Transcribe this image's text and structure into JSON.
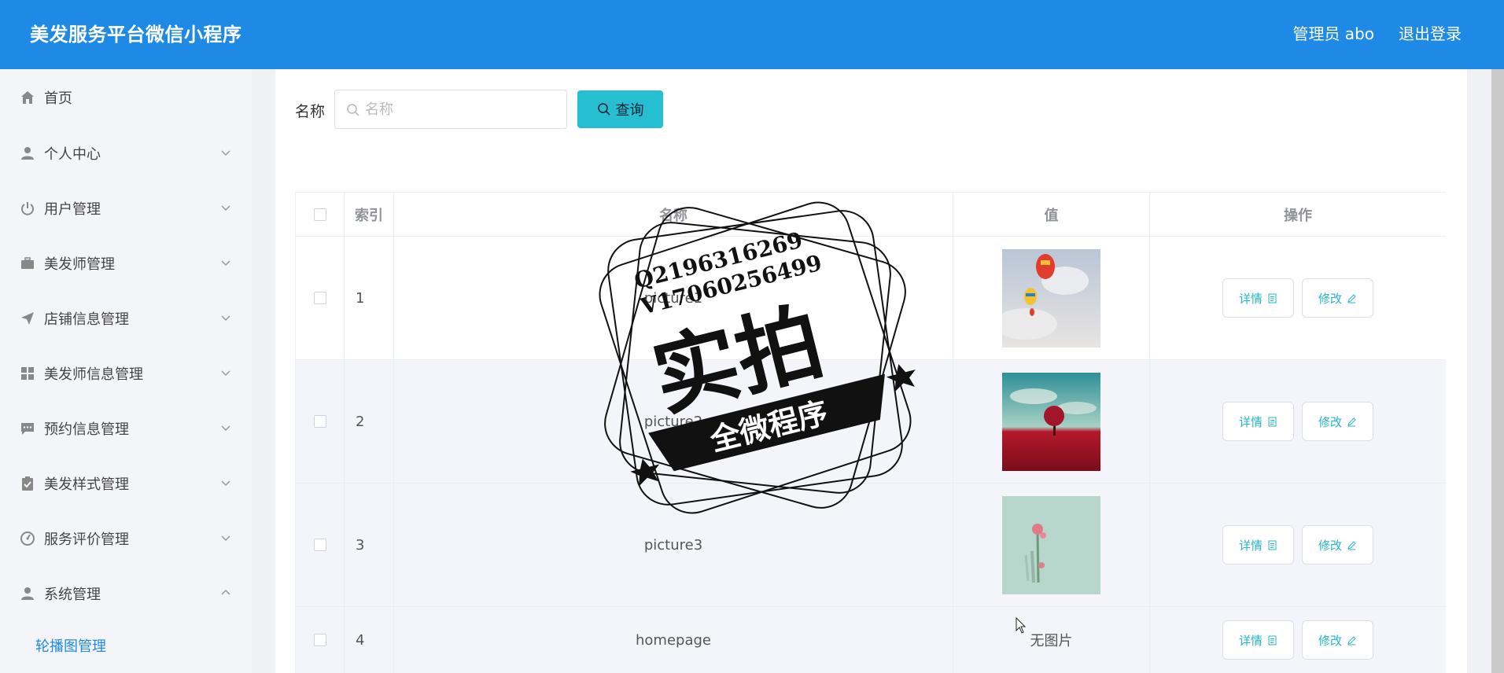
{
  "header": {
    "title": "美发服务平台微信小程序",
    "user_label": "管理员 abo",
    "logout_label": "退出登录"
  },
  "sidebar": {
    "items": [
      {
        "label": "首页",
        "icon": "home-icon",
        "expandable": false
      },
      {
        "label": "个人中心",
        "icon": "user-icon",
        "expandable": true
      },
      {
        "label": "用户管理",
        "icon": "power-icon",
        "expandable": true
      },
      {
        "label": "美发师管理",
        "icon": "briefcase-icon",
        "expandable": true
      },
      {
        "label": "店铺信息管理",
        "icon": "send-icon",
        "expandable": true
      },
      {
        "label": "美发师信息管理",
        "icon": "grid-icon",
        "expandable": true
      },
      {
        "label": "预约信息管理",
        "icon": "message-icon",
        "expandable": true
      },
      {
        "label": "美发样式管理",
        "icon": "clipboard-icon",
        "expandable": true
      },
      {
        "label": "服务评价管理",
        "icon": "gauge-icon",
        "expandable": true
      },
      {
        "label": "系统管理",
        "icon": "user-icon",
        "expandable": true,
        "expanded": true
      }
    ],
    "sub_item": "轮播图管理"
  },
  "search": {
    "label": "名称",
    "placeholder": "名称",
    "value": "",
    "button_label": "查询"
  },
  "table": {
    "columns": [
      "索引",
      "名称",
      "值",
      "操作"
    ],
    "rows": [
      {
        "index": "1",
        "name": "picture1",
        "value_type": "image",
        "image": "hot-air-balloons"
      },
      {
        "index": "2",
        "name": "picture2",
        "value_type": "image",
        "image": "red-tree-field"
      },
      {
        "index": "3",
        "name": "picture3",
        "value_type": "image",
        "image": "pink-flower"
      },
      {
        "index": "4",
        "name": "homepage",
        "value_type": "text",
        "value": "无图片"
      }
    ],
    "detail_label": "详情",
    "edit_label": "修改"
  },
  "watermark": {
    "line1": "Q2196316269",
    "line2": "V17060256499",
    "big_text": "实拍",
    "ribbon_text": "全微程序"
  },
  "colors": {
    "header_bg": "#1f8ae6",
    "accent": "#25bfd1",
    "sidebar_bg": "#f4f5f8"
  }
}
